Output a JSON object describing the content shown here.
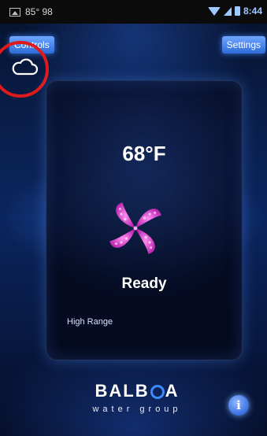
{
  "status_bar": {
    "left_text": "85° 98",
    "time": "8:44",
    "icons": [
      "image-icon",
      "wifi-icon",
      "signal-icon",
      "battery-icon"
    ]
  },
  "header": {
    "controls_label": "Controls",
    "settings_label": "Settings"
  },
  "cloud": {
    "icon": "cloud-icon",
    "annotation_color": "#e01a1a"
  },
  "card": {
    "temperature": "68°F",
    "status": "Ready",
    "range": "High Range",
    "pinwheel_color": "#e040d0"
  },
  "footer": {
    "brand": "BALB",
    "brand_tail": "A",
    "tagline": "water group",
    "info_label": "i"
  },
  "colors": {
    "accent": "#2e6bd8",
    "background": "#0b255e"
  }
}
